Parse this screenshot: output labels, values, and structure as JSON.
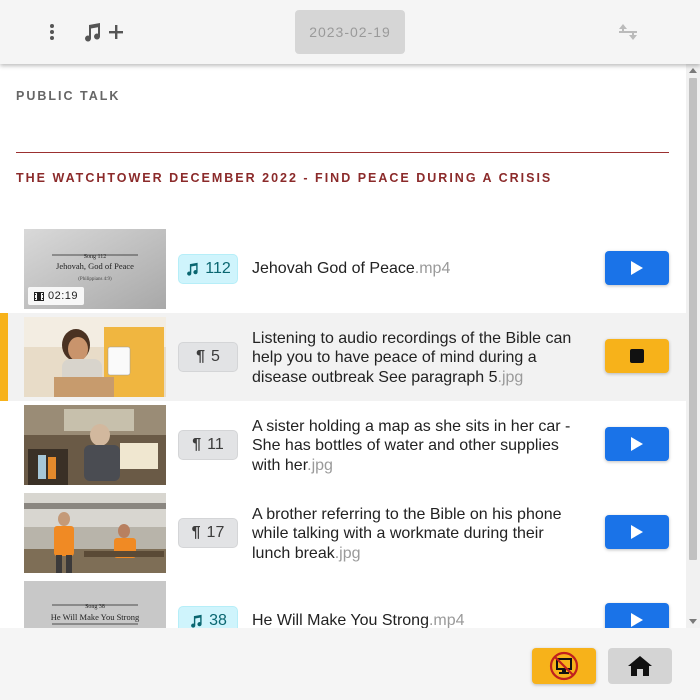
{
  "header": {
    "date_label": "2023-02-19",
    "icons": [
      "more-vert-icon",
      "music-note-icon",
      "plus-icon",
      "sort-arrows-icon"
    ]
  },
  "sections": {
    "public_talk": "PUBLIC TALK",
    "watchtower": "THE WATCHTOWER DECEMBER 2022 - FIND PEACE DURING A CRISIS"
  },
  "items": [
    {
      "badge_type": "song",
      "badge_value": "112",
      "title": "Jehovah God of Peace",
      "ext": ".mp4",
      "duration": "02:19",
      "thumb_text": [
        "Song 112",
        "Jehovah, God of Peace",
        "(Philippians 4:9)"
      ],
      "action": "play"
    },
    {
      "badge_type": "paragraph",
      "badge_value": "5",
      "title": "Listening to audio recordings of the Bible can help you to have peace of mind during a disease outbreak See paragraph 5",
      "ext": ".jpg",
      "action": "stop"
    },
    {
      "badge_type": "paragraph",
      "badge_value": "11",
      "title": "A sister holding a map as she sits in her car - She has bottles of water and other supplies with her",
      "ext": ".jpg",
      "action": "play"
    },
    {
      "badge_type": "paragraph",
      "badge_value": "17",
      "title": "A brother referring to the Bible on his phone while talking with a workmate during their lunch break",
      "ext": ".jpg",
      "action": "play"
    },
    {
      "badge_type": "song",
      "badge_value": "38",
      "title": "He Will Make You Strong",
      "ext": ".mp4",
      "thumb_text": [
        "Song 38",
        "He Will Make You Strong"
      ],
      "action": "play"
    }
  ],
  "footer": {
    "icons": [
      "presentation-off-icon",
      "home-icon"
    ]
  },
  "colors": {
    "accent_yellow": "#f7b21a",
    "play_blue": "#1a73e8",
    "section_red": "#8b2a2a"
  }
}
